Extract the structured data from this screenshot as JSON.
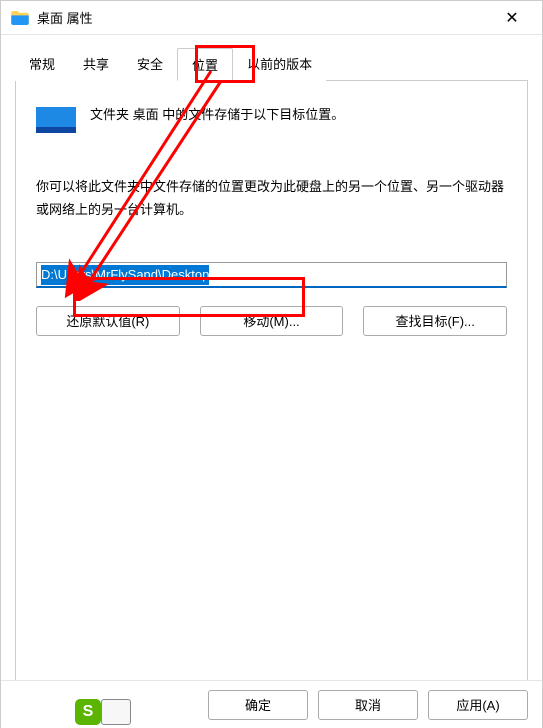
{
  "window": {
    "title": "桌面 属性"
  },
  "tabs": {
    "items": [
      {
        "label": "常规"
      },
      {
        "label": "共享"
      },
      {
        "label": "安全"
      },
      {
        "label": "位置",
        "active": true
      },
      {
        "label": "以前的版本"
      }
    ]
  },
  "panel": {
    "intro": "文件夹 桌面 中的文件存储于以下目标位置。",
    "desc": "你可以将此文件夹中文件存储的位置更改为此硬盘上的另一个位置、另一个驱动器或网络上的另一台计算机。",
    "path_value": "D:\\Users\\MrFlySand\\Desktop",
    "buttons": {
      "restore": "还原默认值(R)",
      "move": "移动(M)...",
      "find": "查找目标(F)..."
    }
  },
  "footer": {
    "ok": "确定",
    "cancel": "取消",
    "apply": "应用(A)"
  },
  "icons": {
    "folder_color": "#2196f3"
  },
  "badge": {
    "label": "S"
  }
}
